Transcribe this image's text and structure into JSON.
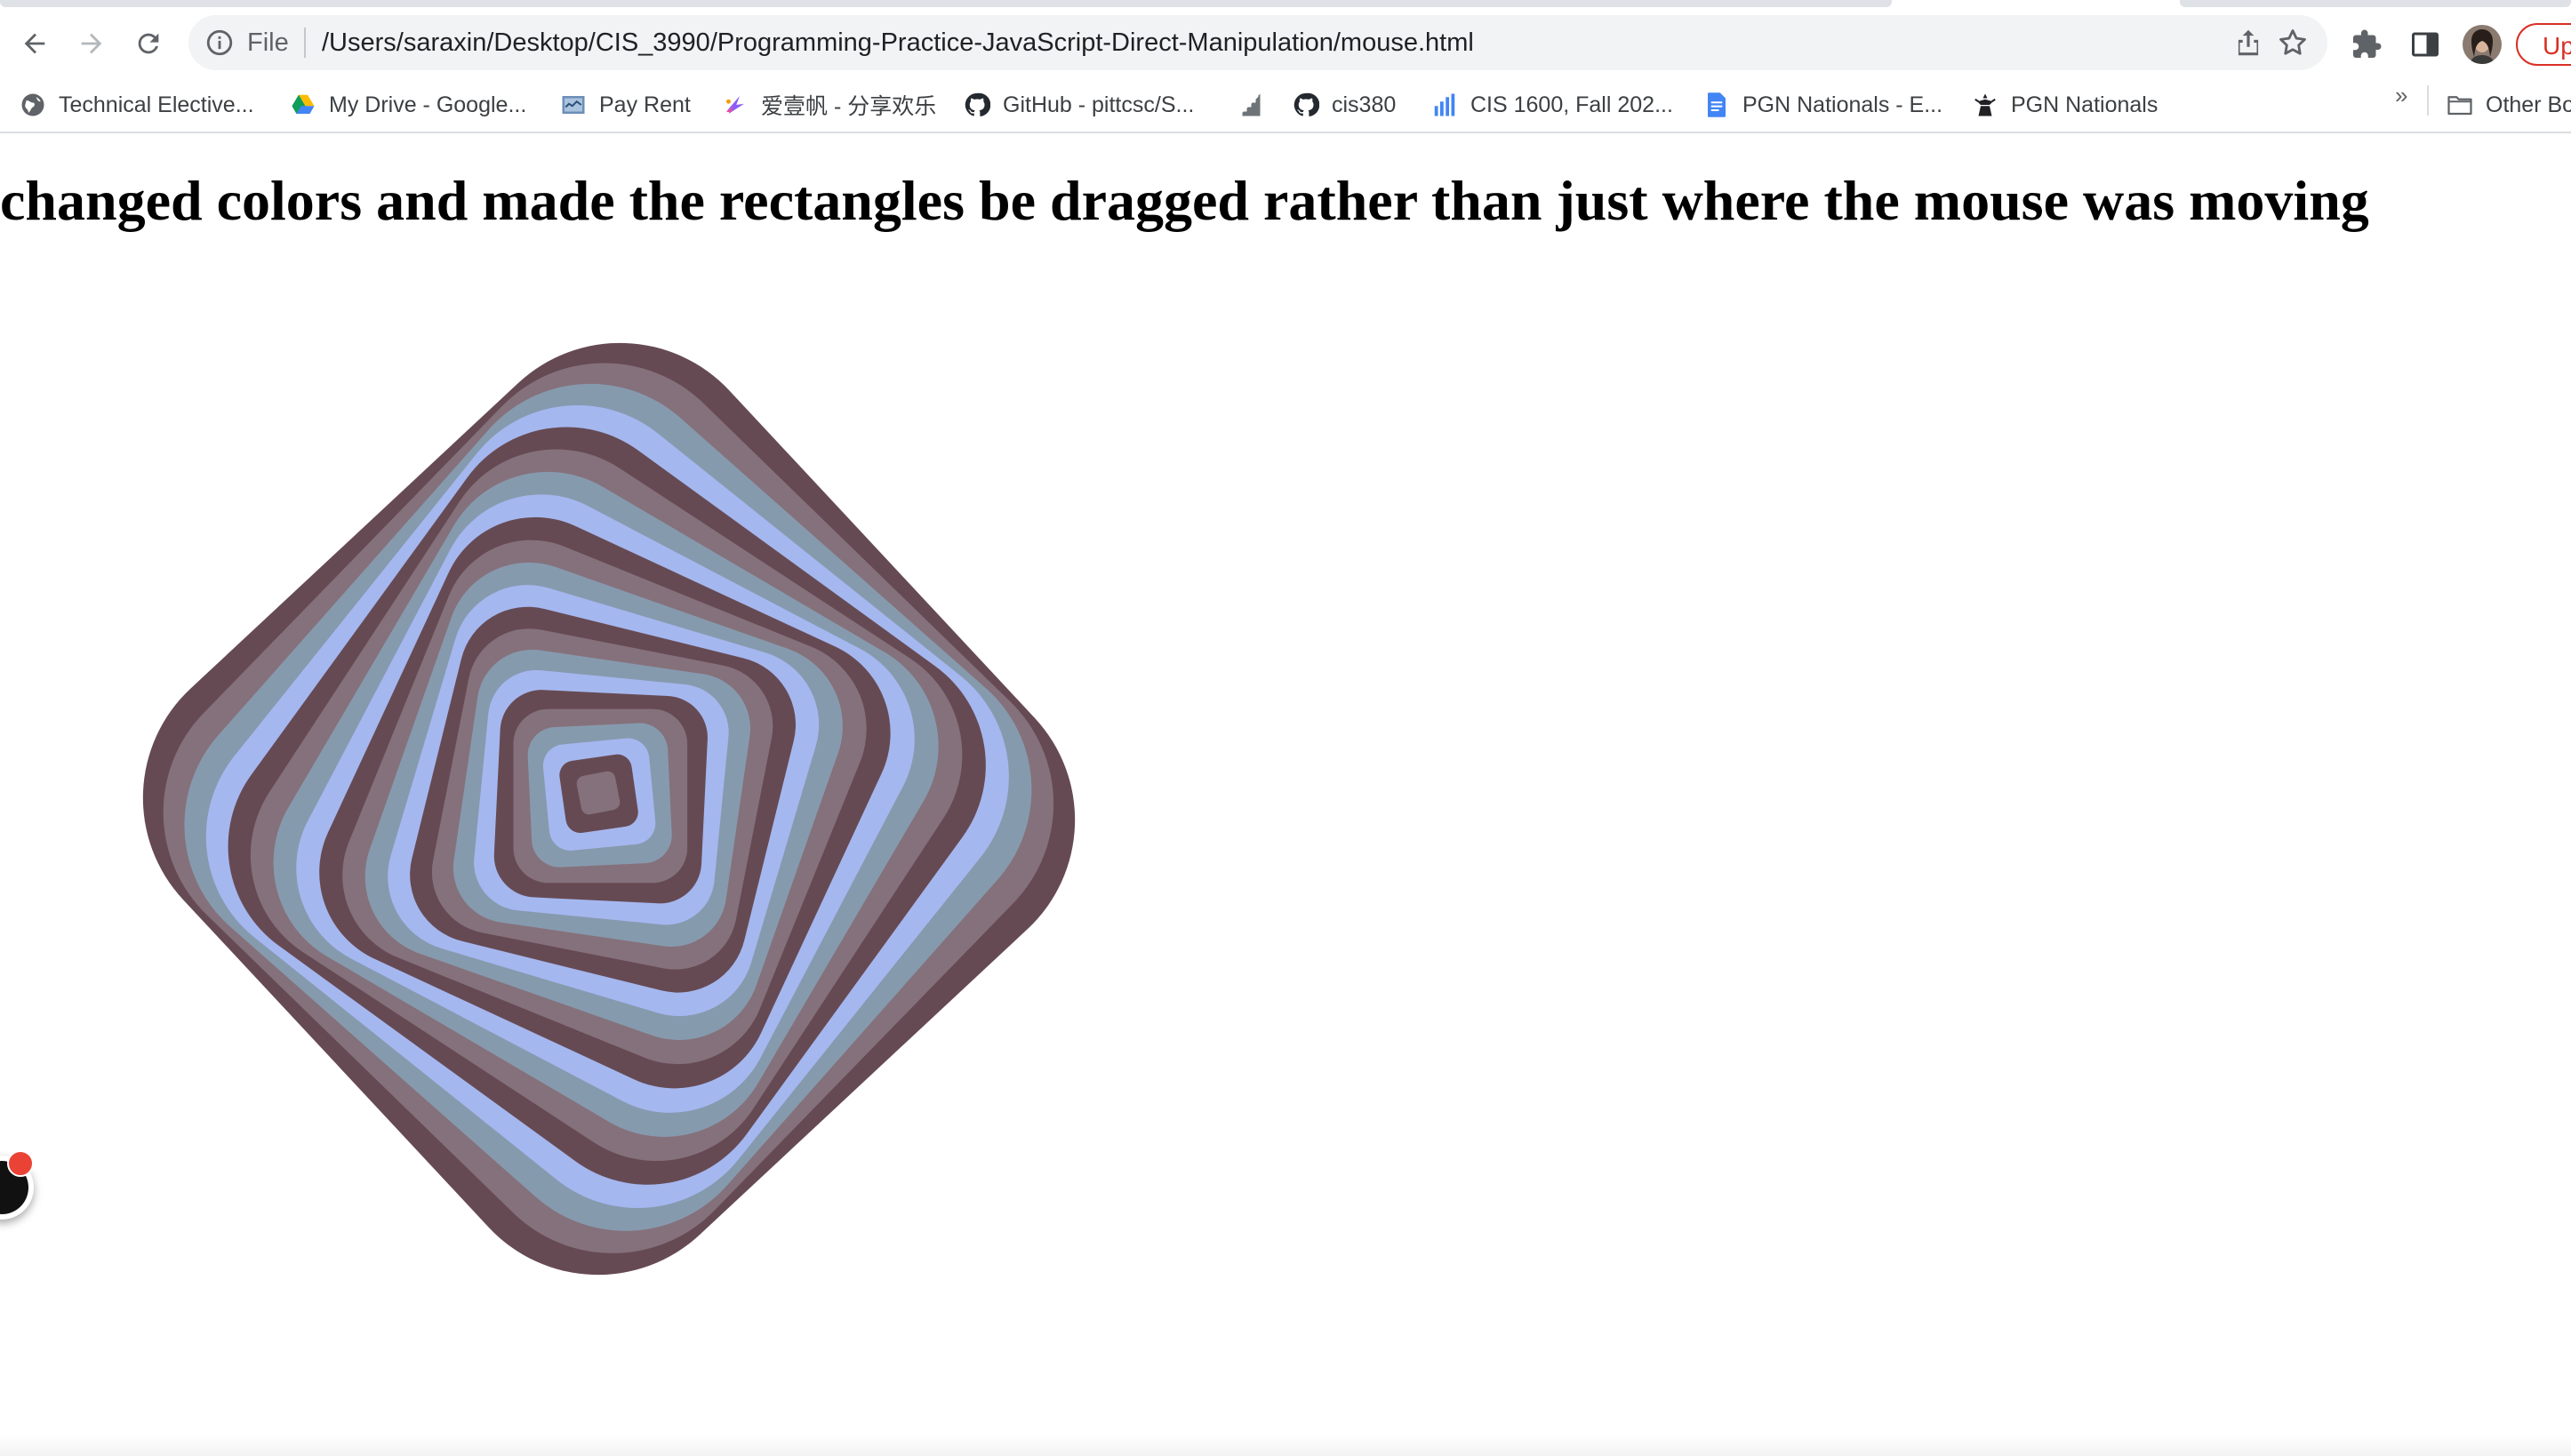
{
  "browser": {
    "address_scheme": "File",
    "address_url": "/Users/saraxin/Desktop/CIS_3990/Programming-Practice-JavaScript-Direct-Manipulation/mouse.html",
    "update_label": "Upd",
    "overflow_chevron": "»"
  },
  "bookmarks": [
    {
      "label": "Technical Elective...",
      "icon": "globe-icon"
    },
    {
      "label": "My Drive - Google...",
      "icon": "google-drive-icon"
    },
    {
      "label": "Pay Rent",
      "icon": "pay-rent-icon"
    },
    {
      "label": "爱壹帆 - 分享欢乐",
      "icon": "aiyifan-icon"
    },
    {
      "label": "GitHub - pittcsc/S...",
      "icon": "github-icon"
    },
    {
      "label": "",
      "icon": "stairs-icon"
    },
    {
      "label": "cis380",
      "icon": "github-icon"
    },
    {
      "label": "CIS 1600, Fall 202...",
      "icon": "bar-chart-icon"
    },
    {
      "label": "PGN Nationals - E...",
      "icon": "google-docs-icon"
    },
    {
      "label": "PGN Nationals",
      "icon": "pgn-icon"
    },
    {
      "label": "Other Bo",
      "icon": "folder-icon"
    }
  ],
  "page": {
    "heading": "changed colors and made the rectangles be dragged rather than just where the mouse was moving"
  },
  "colors": {
    "art": [
      "#664a53",
      "#85717b",
      "#869aae",
      "#a5b7ef"
    ]
  }
}
